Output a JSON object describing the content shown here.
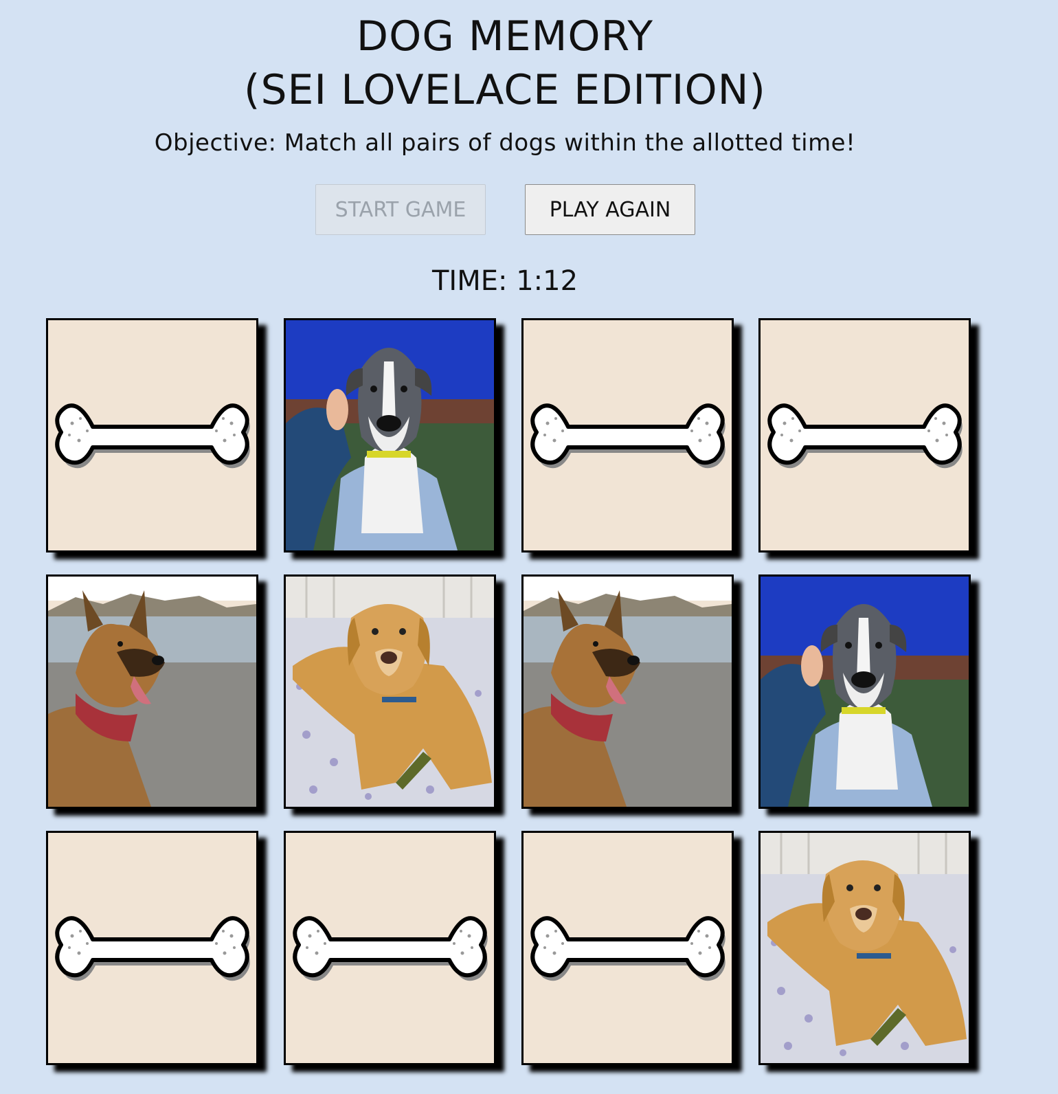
{
  "header": {
    "title_line1": "DOG MEMORY",
    "title_line2": "(SEI LOVELACE EDITION)",
    "objective": "Objective: Match all pairs of dogs within the allotted time!"
  },
  "buttons": {
    "start_label": "START GAME",
    "start_disabled": true,
    "again_label": "PLAY AGAIN"
  },
  "timer": {
    "text": "TIME: 1:12"
  },
  "board": {
    "rows": 3,
    "columns": 4,
    "cards": [
      {
        "state": "face-down",
        "image": "bone-icon"
      },
      {
        "state": "face-up",
        "image": "grey-pitbull-photo"
      },
      {
        "state": "face-down",
        "image": "bone-icon"
      },
      {
        "state": "face-down",
        "image": "bone-icon"
      },
      {
        "state": "face-up",
        "image": "german-shepherd-beach-photo"
      },
      {
        "state": "face-up",
        "image": "golden-dog-blanket-photo"
      },
      {
        "state": "face-up",
        "image": "german-shepherd-beach-photo"
      },
      {
        "state": "face-up",
        "image": "grey-pitbull-photo"
      },
      {
        "state": "face-down",
        "image": "bone-icon"
      },
      {
        "state": "face-down",
        "image": "bone-icon"
      },
      {
        "state": "face-down",
        "image": "bone-icon"
      },
      {
        "state": "face-up",
        "image": "golden-dog-blanket-photo"
      }
    ]
  },
  "colors": {
    "background": "#d4e2f3",
    "card_back": "#f1e4d5",
    "card_border": "#000000"
  }
}
